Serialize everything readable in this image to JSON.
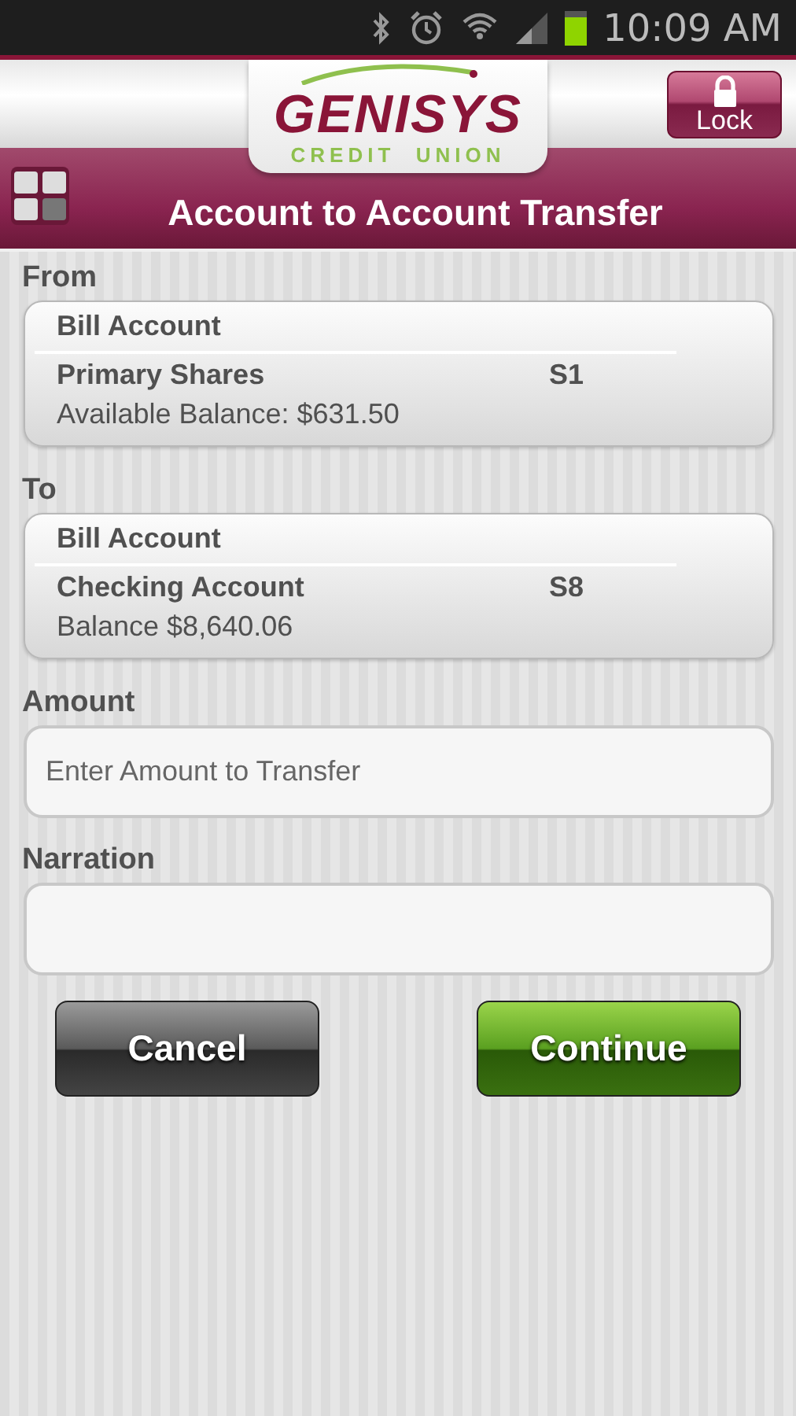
{
  "status_bar": {
    "time": "10:09 AM"
  },
  "header": {
    "logo_name": "GENISYS",
    "logo_tagline": "CREDIT  UNION",
    "lock_button": "Lock",
    "title": "Account to Account Transfer"
  },
  "from": {
    "label": "From",
    "account": {
      "type": "Bill Account",
      "name": "Primary Shares",
      "code": "S1",
      "balance": "Available Balance: $631.50"
    }
  },
  "to": {
    "label": "To",
    "account": {
      "type": "Bill Account",
      "name": "Checking Account",
      "code": "S8",
      "balance": "Balance $8,640.06"
    }
  },
  "fields": [
    {
      "label": "Amount",
      "placeholder": "Enter Amount to Transfer"
    },
    {
      "label": "Narration"
    }
  ],
  "buttons": [
    {
      "label": "Cancel",
      "kind": "dark"
    },
    {
      "label": "Continue",
      "kind": "green"
    }
  ]
}
